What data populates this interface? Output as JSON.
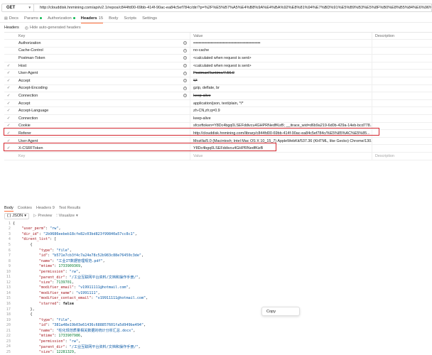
{
  "request": {
    "method": "GET",
    "url": "http://clouddisk.hnmining.com/api/v2.1/repos/c844fd00-69bb-414f-90ac-ea84c5ef784c/dir/?p=%2F%E5%B7%A5%E4%B8%9A%E4%BA%92%E8%81%94%E7%BD%91%E5%B9%B3%E5%8F%B0%E8%B5%84%E6%96%99%2F%E6%96%"
  },
  "tabs": [
    {
      "label": "Docs",
      "icon": "doc-icon",
      "active": false
    },
    {
      "label": "Params",
      "active": false,
      "dot": true
    },
    {
      "label": "Authorization",
      "active": false,
      "dot": true
    },
    {
      "label": "Headers",
      "count": "15",
      "active": true
    },
    {
      "label": "Body",
      "active": false
    },
    {
      "label": "Scripts",
      "active": false
    },
    {
      "label": "Settings",
      "active": false
    }
  ],
  "headers_toolbar": {
    "title": "Headers",
    "hide_auto": "Hide auto-generated headers"
  },
  "table_head": {
    "key": "Key",
    "value": "Value",
    "description": "Description"
  },
  "headers": [
    {
      "check": "",
      "key": "Authorization",
      "value": "••••••••••••••••••••••••••••••••••••••••••••••••••",
      "info": true
    },
    {
      "check": "",
      "key": "Cache-Control",
      "value": "no-cache",
      "info": true
    },
    {
      "check": "",
      "key": "Postman-Token",
      "value": "<calculated when request is sent>",
      "info": true
    },
    {
      "check": "✓",
      "key": "Host",
      "value": "<calculated when request is sent>",
      "info": true
    },
    {
      "check": "✓",
      "key": "User-Agent",
      "value": "PostmanRuntime/7.56.0",
      "info": true,
      "strike": true
    },
    {
      "check": "✓",
      "key": "Accept",
      "value": "*/*",
      "info": true,
      "strike": true
    },
    {
      "check": "✓",
      "key": "Accept-Encoding",
      "value": "gzip, deflate, br",
      "info": true
    },
    {
      "check": "✓",
      "key": "Connection",
      "value": "keep-alive",
      "info": true,
      "strike": true
    },
    {
      "check": "✓",
      "key": "Accept",
      "value": "application/json, text/plain, */*"
    },
    {
      "check": "✓",
      "key": "Accept-Language",
      "value": "zh-CN,zh;q=0.9"
    },
    {
      "check": "✓",
      "key": "Connection",
      "value": "keep-alive"
    },
    {
      "check": "✓",
      "key": "Cookie",
      "value": "sfcsrftoken=Y8Dc4bgq0LSEFddivcu4GHPRNedfKizB; __itrace_wid=d6b9a219-6d0b-429a-14eb-bcd778..."
    },
    {
      "check": "✓",
      "key": "Referer",
      "value": "http://clouddisk.hnmining.com/library/c844fd00-69bb-414f-90ac-ea84c5ef784c/%E5%85%AC%E5%85..."
    },
    {
      "check": "✓",
      "key": "User-Agent",
      "value": "Mozilla/5.0 (Macintosh; Intel Mac OS X 10_15_7) AppleWebKit/537.36 (KHTML, like Gecko) Chrome/130.0..."
    },
    {
      "check": "✓",
      "key": "X-CSRFToken",
      "value": "Y8Dc4bgq0LSEFddivcu4GHPRNedfKizB"
    },
    {
      "check": "",
      "key": "Key",
      "value": "Value",
      "placeholder": true,
      "desc": "Description"
    }
  ],
  "response_tabs": [
    {
      "label": "Body",
      "active": true
    },
    {
      "label": "Cookies",
      "active": false
    },
    {
      "label": "Headers",
      "count": "9",
      "active": false
    },
    {
      "label": "Test Results",
      "active": false
    }
  ],
  "response_toolbar": {
    "format": "JSON",
    "preview": "Preview",
    "visualize": "Visualize"
  },
  "code_lines": [
    {
      "n": "1",
      "parts": [
        [
          "txt",
          "{"
        ]
      ]
    },
    {
      "n": "2",
      "parts": [
        [
          "txt",
          "    "
        ],
        [
          "k",
          "\"user_perm\""
        ],
        [
          "txt",
          ": "
        ],
        [
          "s",
          "\"rw\""
        ],
        [
          "txt",
          ","
        ]
      ]
    },
    {
      "n": "3",
      "parts": [
        [
          "txt",
          "    "
        ],
        [
          "k",
          "\"dir_id\""
        ],
        [
          "txt",
          ": "
        ],
        [
          "s",
          "\"2b9686eebeb18cfe82c03bd823f99840a57cc8c1\""
        ],
        [
          "txt",
          ","
        ]
      ]
    },
    {
      "n": "4",
      "parts": [
        [
          "txt",
          "    "
        ],
        [
          "k",
          "\"dirent_list\""
        ],
        [
          "txt",
          ": ["
        ]
      ]
    },
    {
      "n": "5",
      "parts": [
        [
          "txt",
          "        {"
        ]
      ]
    },
    {
      "n": "6",
      "parts": [
        [
          "txt",
          "            "
        ],
        [
          "k",
          "\"type\""
        ],
        [
          "txt",
          ": "
        ],
        [
          "s",
          "\"file\""
        ],
        [
          "txt",
          ","
        ]
      ]
    },
    {
      "n": "7",
      "parts": [
        [
          "txt",
          "            "
        ],
        [
          "k",
          "\"id\""
        ],
        [
          "txt",
          ": "
        ],
        [
          "s",
          "\"b571e7cb3f4c7a24e78c52b983c88e76450c3de\""
        ],
        [
          "txt",
          ","
        ]
      ]
    },
    {
      "n": "8",
      "parts": [
        [
          "txt",
          "            "
        ],
        [
          "k",
          "\"name\""
        ],
        [
          "txt",
          ": "
        ],
        [
          "s",
          "\"工业IT数据管理规范.pdf\""
        ],
        [
          "txt",
          ","
        ]
      ]
    },
    {
      "n": "9",
      "parts": [
        [
          "txt",
          "            "
        ],
        [
          "k",
          "\"mtime\""
        ],
        [
          "txt",
          ": "
        ],
        [
          "n",
          "1733909369"
        ],
        [
          "txt",
          ","
        ]
      ]
    },
    {
      "n": "10",
      "parts": [
        [
          "txt",
          "            "
        ],
        [
          "k",
          "\"permission\""
        ],
        [
          "txt",
          ": "
        ],
        [
          "s",
          "\"rw\""
        ],
        [
          "txt",
          ","
        ]
      ]
    },
    {
      "n": "11",
      "parts": [
        [
          "txt",
          "            "
        ],
        [
          "k",
          "\"parent_dir\""
        ],
        [
          "txt",
          ": "
        ],
        [
          "s",
          "\"/工业互联网平台资料/文档和操作手册/\""
        ],
        [
          "txt",
          ","
        ]
      ]
    },
    {
      "n": "12",
      "parts": [
        [
          "txt",
          "            "
        ],
        [
          "k",
          "\"size\""
        ],
        [
          "txt",
          ": "
        ],
        [
          "n",
          "7139701"
        ],
        [
          "txt",
          ","
        ]
      ]
    },
    {
      "n": "13",
      "parts": [
        [
          "txt",
          "            "
        ],
        [
          "k",
          "\"modifier_email\""
        ],
        [
          "txt",
          ": "
        ],
        [
          "s",
          "\"v19911111@hotmail.com\""
        ],
        [
          "txt",
          ","
        ]
      ]
    },
    {
      "n": "14",
      "parts": [
        [
          "txt",
          "            "
        ],
        [
          "k",
          "\"modifier_name\""
        ],
        [
          "txt",
          ": "
        ],
        [
          "s",
          "\"v1991111\""
        ],
        [
          "txt",
          ","
        ]
      ]
    },
    {
      "n": "15",
      "parts": [
        [
          "txt",
          "            "
        ],
        [
          "k",
          "\"modifier_contact_email\""
        ],
        [
          "txt",
          ": "
        ],
        [
          "s",
          "\"v19911111@hotmail.com\""
        ],
        [
          "txt",
          ","
        ]
      ]
    },
    {
      "n": "16",
      "parts": [
        [
          "txt",
          "            "
        ],
        [
          "k",
          "\"starred\""
        ],
        [
          "txt",
          ": "
        ],
        [
          "b",
          "false"
        ]
      ]
    },
    {
      "n": "17",
      "parts": [
        [
          "txt",
          "        },"
        ]
      ]
    },
    {
      "n": "18",
      "parts": [
        [
          "txt",
          "        {"
        ]
      ]
    },
    {
      "n": "19",
      "parts": [
        [
          "txt",
          "            "
        ],
        [
          "k",
          "\"type\""
        ],
        [
          "txt",
          ": "
        ],
        [
          "s",
          "\"file\""
        ],
        [
          "txt",
          ","
        ]
      ]
    },
    {
      "n": "20",
      "parts": [
        [
          "txt",
          "            "
        ],
        [
          "k",
          "\"id\""
        ],
        [
          "txt",
          ": "
        ],
        [
          "s",
          "\"381a48e19b03e61436c688857601fa5d949be494\""
        ],
        [
          "txt",
          ","
        ]
      ]
    },
    {
      "n": "21",
      "parts": [
        [
          "txt",
          "            "
        ],
        [
          "k",
          "\"name\""
        ],
        [
          "txt",
          ": "
        ],
        [
          "s",
          "\"柱化规范质量相关数据的统计分析汇总.docx\""
        ],
        [
          "txt",
          ","
        ]
      ]
    },
    {
      "n": "22",
      "parts": [
        [
          "txt",
          "            "
        ],
        [
          "k",
          "\"mtime\""
        ],
        [
          "txt",
          ": "
        ],
        [
          "n",
          "1733907986"
        ],
        [
          "txt",
          ","
        ]
      ]
    },
    {
      "n": "23",
      "parts": [
        [
          "txt",
          "            "
        ],
        [
          "k",
          "\"permission\""
        ],
        [
          "txt",
          ": "
        ],
        [
          "s",
          "\"rw\""
        ],
        [
          "txt",
          ","
        ]
      ]
    },
    {
      "n": "24",
      "parts": [
        [
          "txt",
          "            "
        ],
        [
          "k",
          "\"parent_dir\""
        ],
        [
          "txt",
          ": "
        ],
        [
          "s",
          "\"/工业互联网平台资料/文档和操作手册/\""
        ],
        [
          "txt",
          ","
        ]
      ]
    },
    {
      "n": "25",
      "parts": [
        [
          "txt",
          "            "
        ],
        [
          "k",
          "\"size\""
        ],
        [
          "txt",
          ": "
        ],
        [
          "n",
          "12281329"
        ],
        [
          "txt",
          ","
        ]
      ]
    }
  ],
  "context_menu": {
    "copy": "Copy"
  },
  "colors": {
    "highlight": "#d3262e",
    "accent": "#ff6c37",
    "json_key": "#a3151d",
    "json_string": "#0b5aa6",
    "json_number": "#0a7d37"
  }
}
